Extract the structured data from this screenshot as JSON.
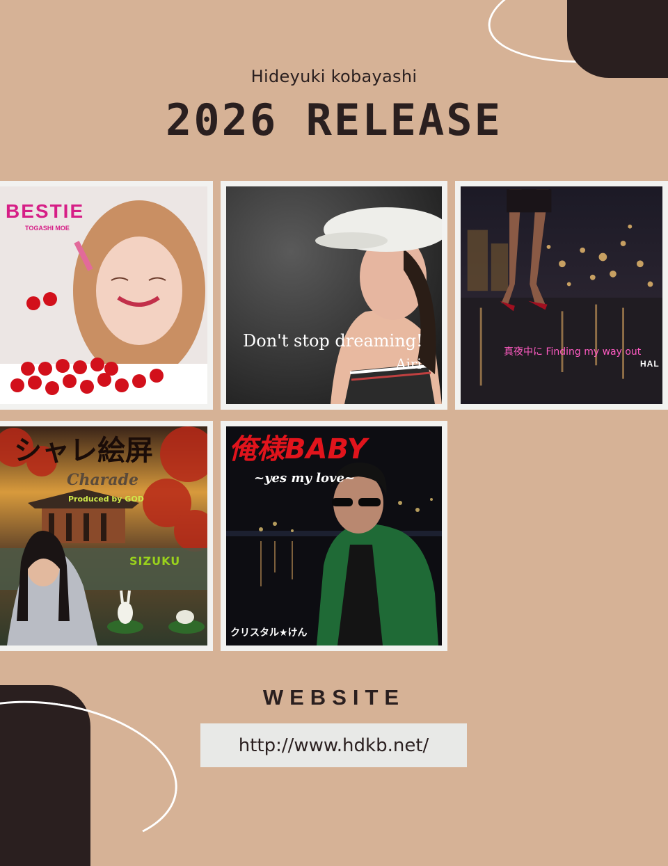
{
  "header": {
    "artist": "Hideyuki kobayashi",
    "title": "2026 RELEASE"
  },
  "releases": [
    {
      "title": "BESTIE",
      "artist": "TOGASHI MOE",
      "icon": "cherries-illustration",
      "colors": {
        "bg": "#ece6e4",
        "accent": "#d61e86"
      }
    },
    {
      "title": "Don't stop dreaming!",
      "artist": "Airi",
      "icon": "portrait-in-cap",
      "colors": {
        "bg": "#3b3b3b",
        "accent": "#ffffff"
      }
    },
    {
      "title": "真夜中に Finding my way out",
      "artist": "HAL",
      "icon": "night-city-legs",
      "colors": {
        "bg": "#1e1a24",
        "accent": "#ff5bc3"
      }
    },
    {
      "title": "シャレ絵屏",
      "subtitle": "Charade",
      "producer": "Produced by GOD",
      "artist": "SIZUKU",
      "icon": "temple-kimono-rabbits",
      "colors": {
        "bg": "#5a3a2a",
        "accent": "#9ad21c"
      }
    },
    {
      "title": "俺様BABY",
      "subtitle": "~yes my love~",
      "artist": "クリスタル★けん",
      "icon": "green-jacket-night-harbor",
      "colors": {
        "bg": "#0f0f14",
        "accent": "#e1141c"
      }
    }
  ],
  "website": {
    "label": "WEBSITE",
    "url": "http://www.hdkb.net/"
  }
}
